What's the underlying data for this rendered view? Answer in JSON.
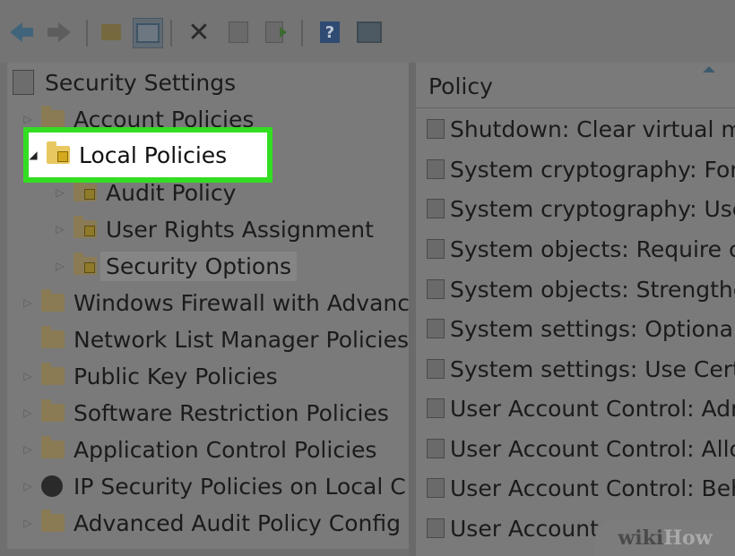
{
  "toolbar": {
    "icons": [
      "back-arrow-icon",
      "forward-arrow-icon",
      "up-folder-icon",
      "show-hide-console-tree-icon",
      "delete-icon",
      "properties-icon",
      "export-list-icon",
      "help-icon",
      "action-pane-icon"
    ]
  },
  "tree": {
    "root_label": "Security Settings",
    "account_policies_label": "Account Policies",
    "local_policies_label": "Local Policies",
    "audit_policy_label": "Audit Policy",
    "user_rights_label": "User Rights Assignment",
    "security_options_label": "Security Options",
    "windows_firewall_label": "Windows Firewall with Advanc",
    "network_list_label": "Network List Manager Policies",
    "public_key_label": "Public Key Policies",
    "software_restriction_label": "Software Restriction Policies",
    "application_control_label": "Application Control Policies",
    "ip_security_label": "IP Security Policies on Local C",
    "advanced_audit_label": "Advanced Audit Policy Config"
  },
  "policy_list": {
    "header": "Policy",
    "items": [
      "Shutdown: Clear virtual m",
      "System cryptography: For",
      "System cryptography: Use",
      "System objects: Require c",
      "System objects: Strengthe",
      "System settings: Optional",
      "System settings: Use Certi",
      "User Account Control: Adr",
      "User Account Control: Allo",
      "User Account Control: Beh",
      "User Account Control: Beh"
    ]
  },
  "watermark": {
    "wiki": "wiki",
    "how": "How"
  },
  "colors": {
    "highlight_border": "#33dd22",
    "dim_overlay": "#7a7a7a"
  }
}
